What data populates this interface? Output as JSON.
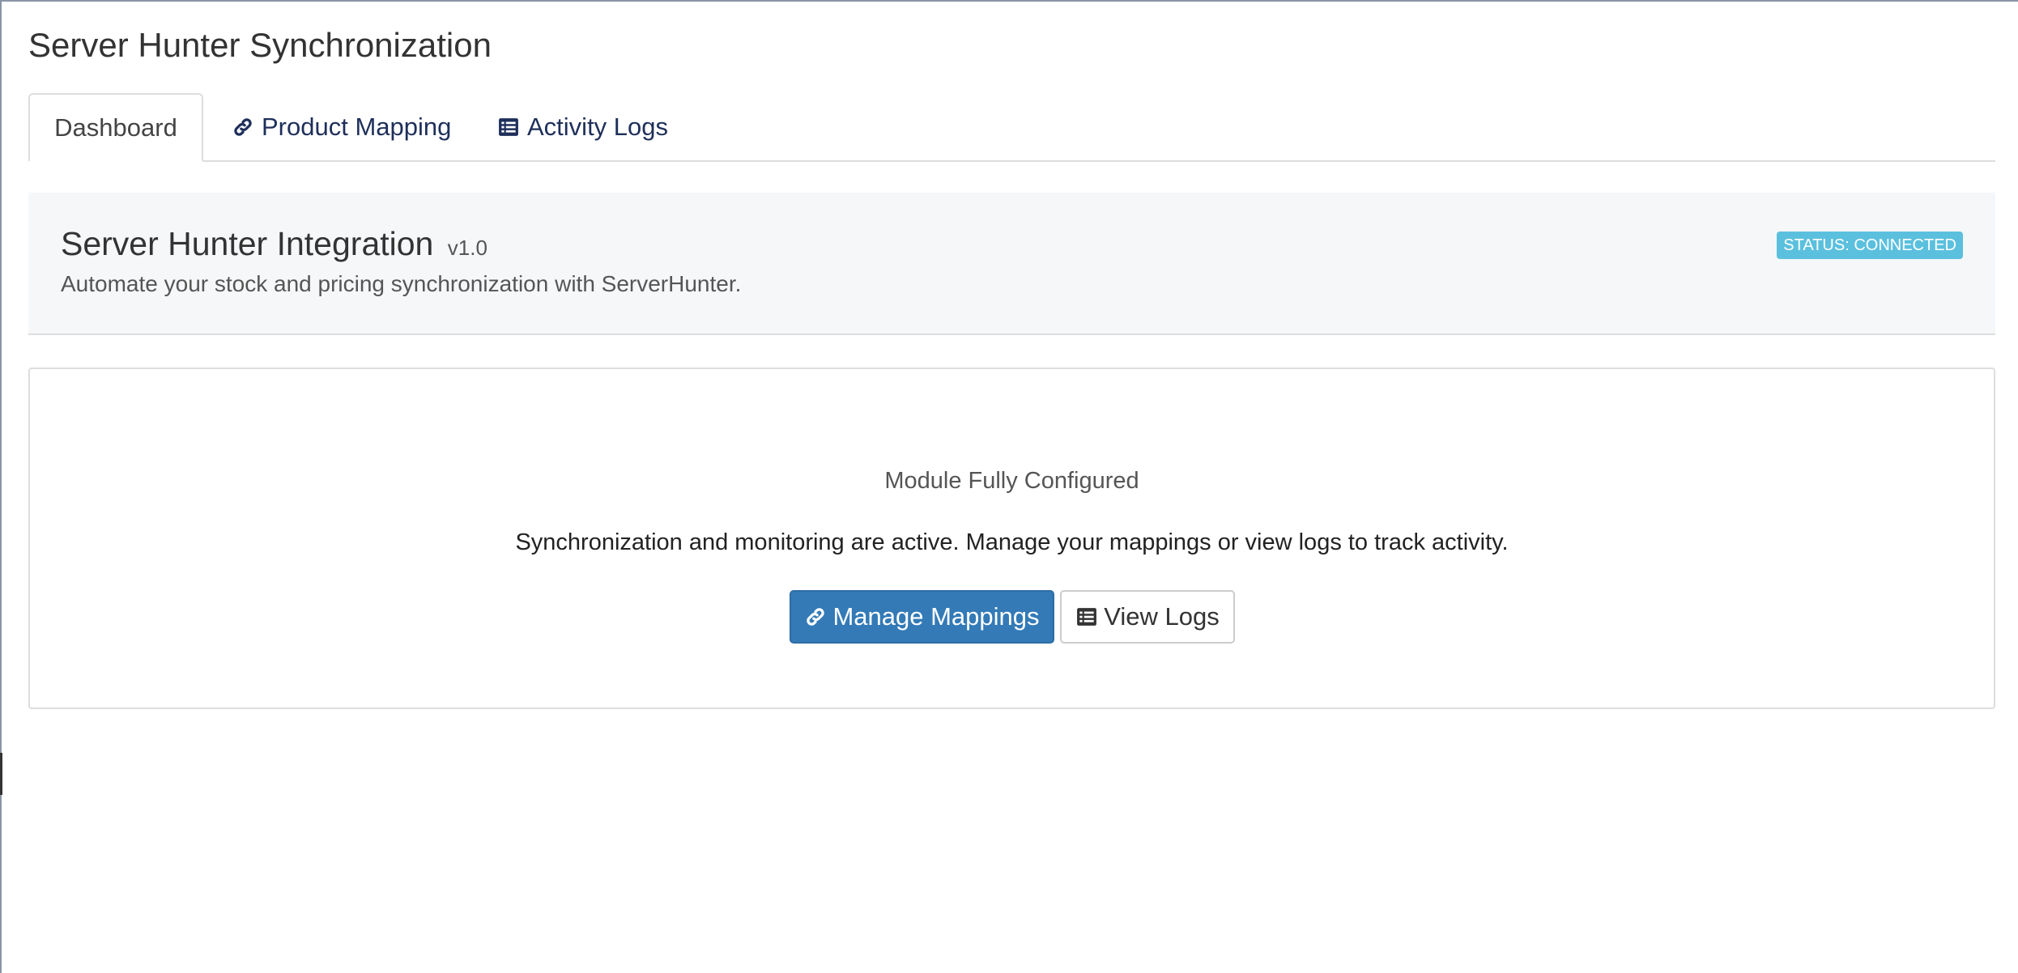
{
  "page": {
    "title": "Server Hunter Synchronization"
  },
  "tabs": [
    {
      "label": "Dashboard",
      "icon": "none",
      "active": true
    },
    {
      "label": "Product Mapping",
      "icon": "link-icon",
      "active": false
    },
    {
      "label": "Activity Logs",
      "icon": "list-icon",
      "active": false
    }
  ],
  "intro": {
    "title": "Server Hunter Integration",
    "version": "v1.0",
    "subtitle": "Automate your stock and pricing synchronization with ServerHunter.",
    "status": "STATUS: CONNECTED"
  },
  "card": {
    "title": "Module Fully Configured",
    "text": "Synchronization and monitoring are active. Manage your mappings or view logs to track activity.",
    "manage_button": "Manage Mappings",
    "logs_button": "View Logs"
  },
  "colors": {
    "primary": "#337ab7",
    "status_badge": "#5bc0de",
    "tab_link": "#1e2f5a"
  }
}
